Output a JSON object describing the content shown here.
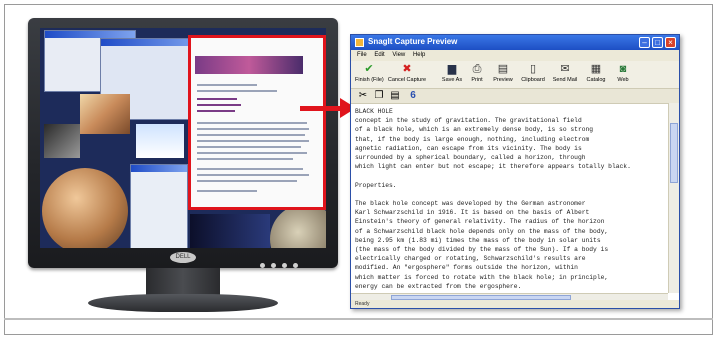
{
  "colors": {
    "accent_red": "#e0141c",
    "title_blue": "#1d4fc4"
  },
  "monitor": {
    "brand": "DELL"
  },
  "preview": {
    "title": "SnagIt Capture Preview",
    "menu": [
      "File",
      "Edit",
      "View",
      "Help"
    ],
    "toolbar": [
      {
        "label": "Finish (File)",
        "icon": "check-icon",
        "glyph": "✔",
        "color": "#2a9a2a"
      },
      {
        "label": "Cancel Capture",
        "icon": "cancel-icon",
        "glyph": "✖",
        "color": "#d42020"
      },
      {
        "label": "Save As",
        "icon": "save-icon",
        "glyph": "▆",
        "color": "#28324a"
      },
      {
        "label": "Print",
        "icon": "print-icon",
        "glyph": "⎙",
        "color": "#333333"
      },
      {
        "label": "Preview",
        "icon": "preview-icon",
        "glyph": "▤",
        "color": "#333333"
      },
      {
        "label": "Clipboard",
        "icon": "clipboard-icon",
        "glyph": "▯",
        "color": "#333333"
      },
      {
        "label": "Send Mail",
        "icon": "mail-icon",
        "glyph": "✉",
        "color": "#333333"
      },
      {
        "label": "Catalog",
        "icon": "catalog-icon",
        "glyph": "▦",
        "color": "#333333"
      },
      {
        "label": "Web",
        "icon": "web-icon",
        "glyph": "◙",
        "color": "#2a7a3a"
      }
    ],
    "document_lines": [
      "BLACK HOLE",
      "concept in the study of gravitation. The gravitational field",
      "of a black hole, which is an extremely dense body, is so strong",
      "that, if the body is large enough, nothing, including electrom",
      "agnetic radiation, can escape from its vicinity. The body is",
      "surrounded by a spherical boundary, called a horizon, through",
      "which light can enter but not escape; it therefore appears totally black.",
      "",
      "Properties.",
      "",
      "The black hole concept was developed by the German astronomer",
      "Karl Schwarzschild in 1916. It is based on the basis of Albert",
      "Einstein's theory of general relativity. The radius of the horizon",
      "of a Schwarzschild black hole depends only on the mass of the body,",
      "being 2.95 km (1.83 mi) times the mass of the body in solar units",
      "(the mass of the body divided by the mass of the Sun). If a body is",
      "electrically charged or rotating, Schwarzschild's results are",
      "modified. An \"ergosphere\" forms outside the horizon, within",
      "which matter is forced to rotate with the black hole; in principle,",
      "energy can be extracted from the ergosphere."
    ],
    "status": "Ready"
  }
}
